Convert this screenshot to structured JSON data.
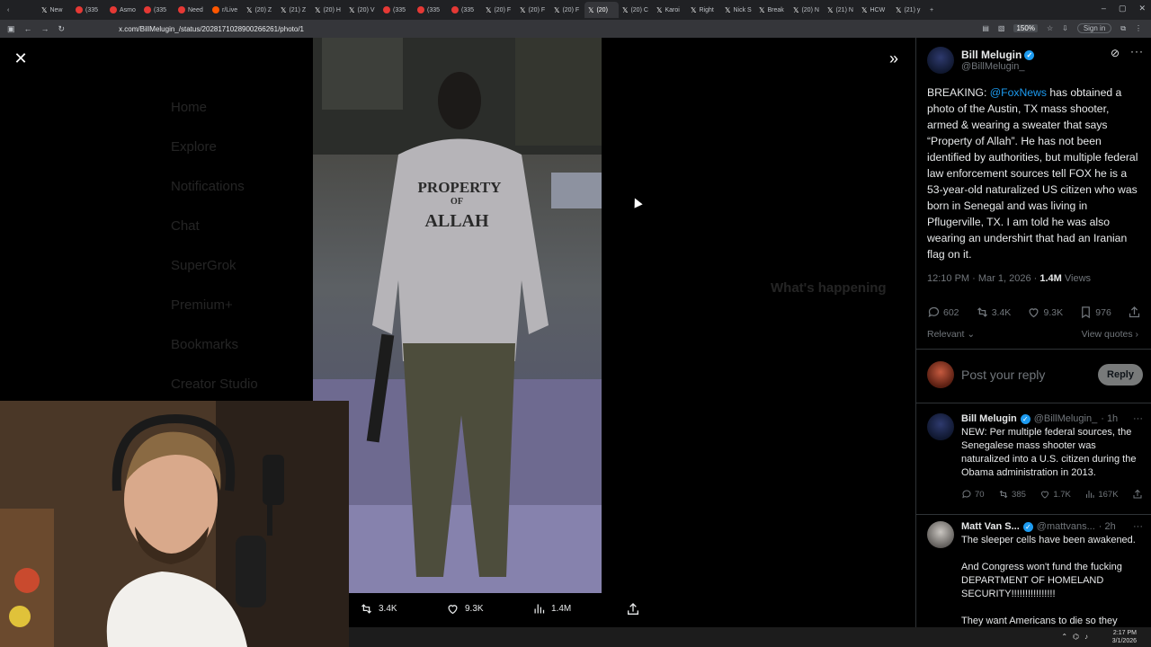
{
  "browser": {
    "tabs": [
      {
        "icon": "x-icon",
        "label": "New"
      },
      {
        "icon": "youtube-icon",
        "label": "(335"
      },
      {
        "icon": "youtube-icon",
        "label": "Asmo"
      },
      {
        "icon": "youtube-icon",
        "label": "(335"
      },
      {
        "icon": "youtube-icon",
        "label": "Need"
      },
      {
        "icon": "reddit-icon",
        "label": "r/Live"
      },
      {
        "icon": "x-icon",
        "label": "(20) Z"
      },
      {
        "icon": "x-icon",
        "label": "(21) Z"
      },
      {
        "icon": "x-icon",
        "label": "(20) H"
      },
      {
        "icon": "x-icon",
        "label": "(20) V"
      },
      {
        "icon": "youtube-icon",
        "label": "(335"
      },
      {
        "icon": "youtube-icon",
        "label": "(335"
      },
      {
        "icon": "youtube-icon",
        "label": "(335"
      },
      {
        "icon": "x-icon",
        "label": "(20) F"
      },
      {
        "icon": "x-icon",
        "label": "(20) F"
      },
      {
        "icon": "x-icon",
        "label": "(20) F"
      },
      {
        "icon": "x-icon",
        "label": "(20)",
        "active": true
      },
      {
        "icon": "x-icon",
        "label": "(20) C"
      },
      {
        "icon": "x-icon",
        "label": "Karoi"
      },
      {
        "icon": "x-icon",
        "label": "Right"
      },
      {
        "icon": "x-icon",
        "label": "Nick S"
      },
      {
        "icon": "x-icon",
        "label": "Break"
      },
      {
        "icon": "x-icon",
        "label": "(20) N"
      },
      {
        "icon": "x-icon",
        "label": "(21) N"
      },
      {
        "icon": "x-icon",
        "label": "HCW"
      },
      {
        "icon": "x-icon",
        "label": "(21) y"
      }
    ],
    "url": "x.com/BillMelugin_/status/2028171028900266261/photo/1",
    "zoom": "150%",
    "sign_in": "Sign in"
  },
  "background": {
    "sidebar": [
      "Home",
      "Explore",
      "Notifications",
      "Chat",
      "SuperGrok",
      "Premium+",
      "Bookmarks",
      "Creator Studio"
    ],
    "trending_title": "What's happening"
  },
  "media": {
    "retweets": "3.4K",
    "likes": "9.3K",
    "views": "1.4M",
    "shirt_text": [
      "PROPERTY",
      "OF",
      "ALLAH"
    ]
  },
  "tweet": {
    "author_name": "Bill Melugin",
    "author_handle": "@BillMelugin_",
    "text_before": "BREAKING: ",
    "mention": "@FoxNews",
    "text_after": " has obtained a photo of the Austin, TX mass shooter, armed & wearing a sweater that says “Property of Allah”. He has not been identified by authorities, but multiple federal law enforcement sources tell FOX he is a 53-year-old naturalized US citizen who was born in Senegal and was living in Pflugerville, TX. I am told he was also wearing an undershirt that had an Iranian flag on it.",
    "time": "12:10 PM · Mar 1, 2026 · ",
    "views_count": "1.4M",
    "views_label": " Views",
    "replies": "602",
    "retweets": "3.4K",
    "likes": "9.3K",
    "bookmarks": "976",
    "sort_label": "Relevant",
    "view_quotes": "View quotes",
    "reply_placeholder": "Post your reply",
    "reply_button": "Reply"
  },
  "replies": [
    {
      "name": "Bill Melugin",
      "handle": "@BillMelugin_",
      "age": "· 1h",
      "text": "NEW: Per multiple federal sources, the Senegalese mass shooter was naturalized into a U.S. citizen during the Obama administration in 2013.",
      "replies": "70",
      "retweets": "385",
      "likes": "1.7K",
      "views": "167K"
    },
    {
      "name": "Matt Van S...",
      "handle": "@mattvans...",
      "age": "· 2h",
      "text": "The sleeper cells have been awakened.\n\nAnd Congress won't fund the fucking DEPARTMENT OF HOMELAND SECURITY!!!!!!!!!!!!!!!!\n\nThey want Americans to die so they"
    }
  ],
  "taskbar": {
    "time": "2:17 PM",
    "date": "3/1/2026"
  }
}
